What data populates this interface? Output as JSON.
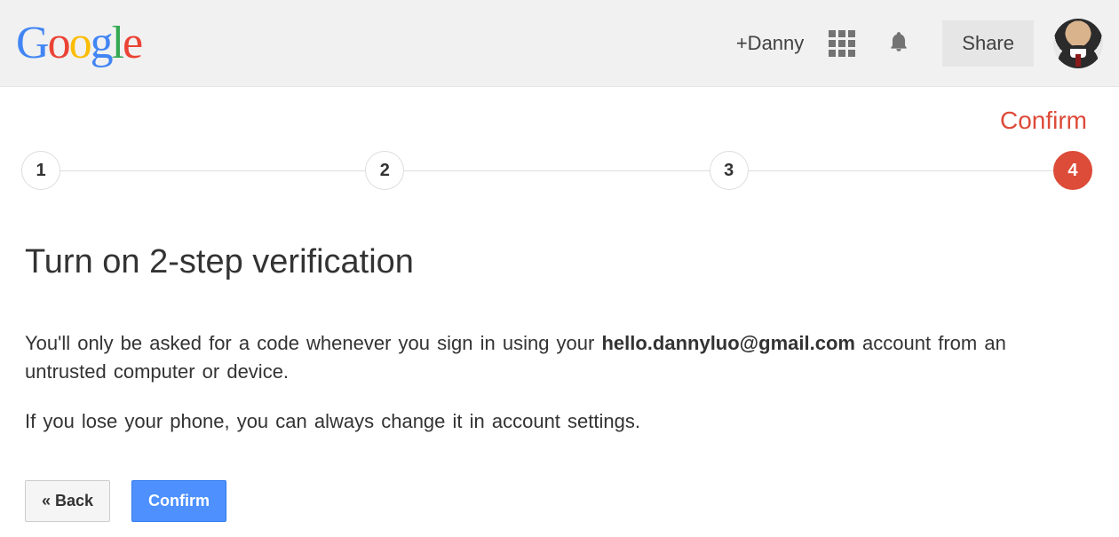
{
  "header": {
    "logo_alt": "Google",
    "profile_name": "+Danny",
    "share_label": "Share"
  },
  "step_heading": "Confirm",
  "steps": [
    "1",
    "2",
    "3",
    "4"
  ],
  "active_step_index": 3,
  "main": {
    "title": "Turn on 2-step verification",
    "desc_part1": "You'll only be asked for a code whenever you sign in using your ",
    "email": "hello.dannyluo@gmail.com",
    "desc_part2": " account from an untrusted computer or device.",
    "desc_line2": "If you lose your phone, you can always change it in account settings."
  },
  "buttons": {
    "back": "« Back",
    "confirm": "Confirm"
  },
  "colors": {
    "accent_red": "#dd4b39",
    "primary_blue": "#4d90fe"
  }
}
